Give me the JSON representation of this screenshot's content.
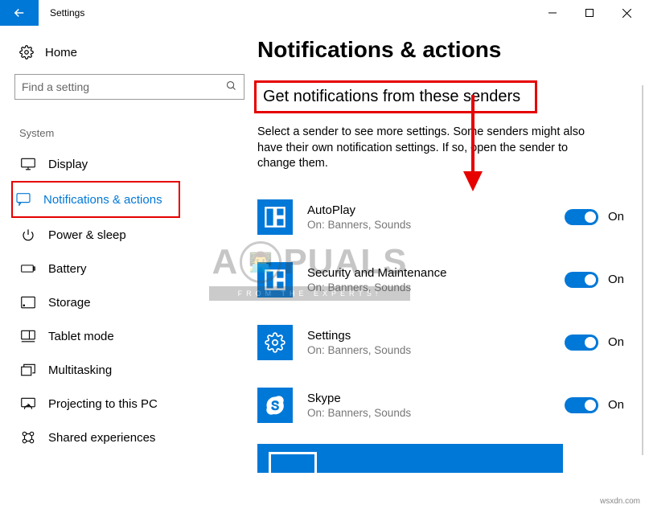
{
  "window": {
    "title": "Settings"
  },
  "sidebar": {
    "home": "Home",
    "search_placeholder": "Find a setting",
    "group": "System",
    "items": [
      {
        "label": "Display"
      },
      {
        "label": "Notifications & actions"
      },
      {
        "label": "Power & sleep"
      },
      {
        "label": "Battery"
      },
      {
        "label": "Storage"
      },
      {
        "label": "Tablet mode"
      },
      {
        "label": "Multitasking"
      },
      {
        "label": "Projecting to this PC"
      },
      {
        "label": "Shared experiences"
      }
    ]
  },
  "main": {
    "title": "Notifications & actions",
    "section_title": "Get notifications from these senders",
    "section_desc": "Select a sender to see more settings. Some senders might also have their own notification settings. If so, open the sender to change them.",
    "on_label": "On",
    "senders": [
      {
        "name": "AutoPlay",
        "sub": "On: Banners, Sounds"
      },
      {
        "name": "Security and Maintenance",
        "sub": "On: Banners, Sounds"
      },
      {
        "name": "Settings",
        "sub": "On: Banners, Sounds"
      },
      {
        "name": "Skype",
        "sub": "On: Banners, Sounds"
      }
    ]
  },
  "watermark": {
    "brand_left": "A",
    "brand_right": "PUALS",
    "tagline": "FROM THE EXPERTS!"
  },
  "footer": "wsxdn.com"
}
